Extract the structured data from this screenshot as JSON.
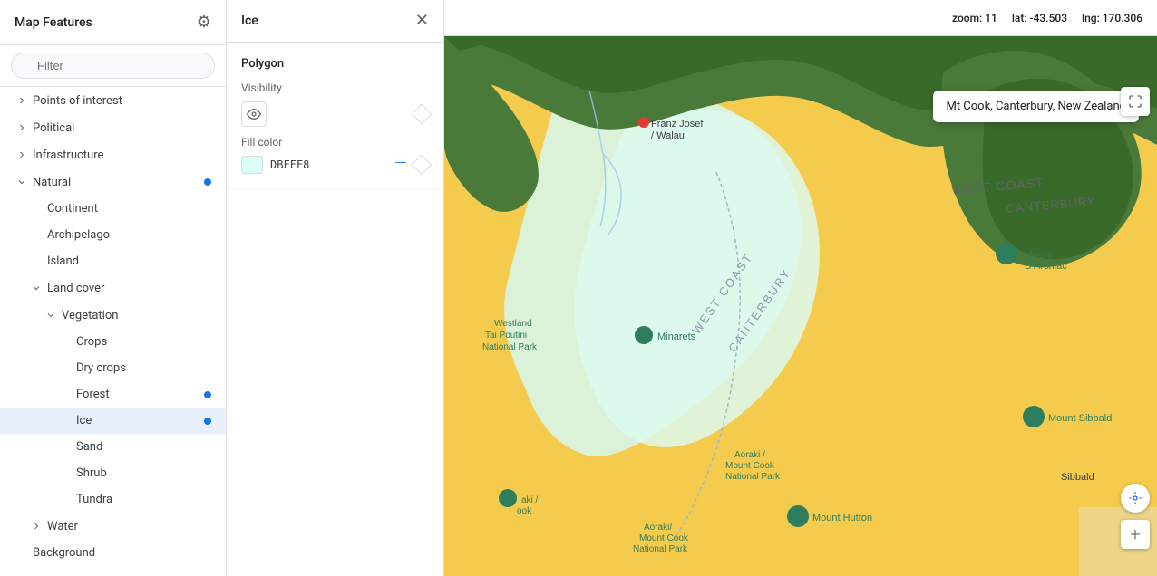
{
  "sidebar": {
    "title": "Map Features",
    "filter": {
      "placeholder": "Filter"
    },
    "items": [
      {
        "id": "points-of-interest",
        "label": "Points of interest",
        "indent": 0,
        "hasChevron": true,
        "chevronDown": false,
        "hasDot": false
      },
      {
        "id": "political",
        "label": "Political",
        "indent": 0,
        "hasChevron": true,
        "chevronDown": false,
        "hasDot": false
      },
      {
        "id": "infrastructure",
        "label": "Infrastructure",
        "indent": 0,
        "hasChevron": true,
        "chevronDown": false,
        "hasDot": false
      },
      {
        "id": "natural",
        "label": "Natural",
        "indent": 0,
        "hasChevron": true,
        "chevronDown": true,
        "hasDot": true
      },
      {
        "id": "continent",
        "label": "Continent",
        "indent": 1,
        "hasChevron": false,
        "hasDot": false
      },
      {
        "id": "archipelago",
        "label": "Archipelago",
        "indent": 1,
        "hasChevron": false,
        "hasDot": false
      },
      {
        "id": "island",
        "label": "Island",
        "indent": 1,
        "hasChevron": false,
        "hasDot": false
      },
      {
        "id": "land-cover",
        "label": "Land cover",
        "indent": 1,
        "hasChevron": true,
        "chevronDown": true,
        "hasDot": false
      },
      {
        "id": "vegetation",
        "label": "Vegetation",
        "indent": 2,
        "hasChevron": true,
        "chevronDown": true,
        "hasDot": false
      },
      {
        "id": "crops",
        "label": "Crops",
        "indent": 3,
        "hasChevron": false,
        "hasDot": false
      },
      {
        "id": "dry-crops",
        "label": "Dry crops",
        "indent": 3,
        "hasChevron": false,
        "hasDot": false
      },
      {
        "id": "forest",
        "label": "Forest",
        "indent": 3,
        "hasChevron": false,
        "hasDot": true
      },
      {
        "id": "ice",
        "label": "Ice",
        "indent": 3,
        "hasChevron": false,
        "hasDot": true,
        "active": true
      },
      {
        "id": "sand",
        "label": "Sand",
        "indent": 3,
        "hasChevron": false,
        "hasDot": false
      },
      {
        "id": "shrub",
        "label": "Shrub",
        "indent": 3,
        "hasChevron": false,
        "hasDot": false
      },
      {
        "id": "tundra",
        "label": "Tundra",
        "indent": 3,
        "hasChevron": false,
        "hasDot": false
      },
      {
        "id": "water",
        "label": "Water",
        "indent": 1,
        "hasChevron": true,
        "chevronDown": false,
        "hasDot": false
      },
      {
        "id": "background",
        "label": "Background",
        "indent": 0,
        "hasChevron": false,
        "hasDot": false
      }
    ]
  },
  "detail": {
    "title": "Ice",
    "type_label": "Polygon",
    "visibility_label": "Visibility",
    "fill_color_label": "Fill color",
    "fill_color_value": "DBFFF8",
    "fill_color_hex": "#DBFFF8"
  },
  "map": {
    "zoom_label": "zoom:",
    "zoom_value": "11",
    "lat_label": "lat:",
    "lat_value": "-43.503",
    "lng_label": "lng:",
    "lng_value": "170.306",
    "tooltip": "Mt Cook, Canterbury, New Zealand"
  },
  "icons": {
    "gear": "⚙",
    "close": "✕",
    "filter": "≡",
    "eye": "👁",
    "fullscreen": "⤢",
    "location": "◎",
    "plus": "+"
  }
}
